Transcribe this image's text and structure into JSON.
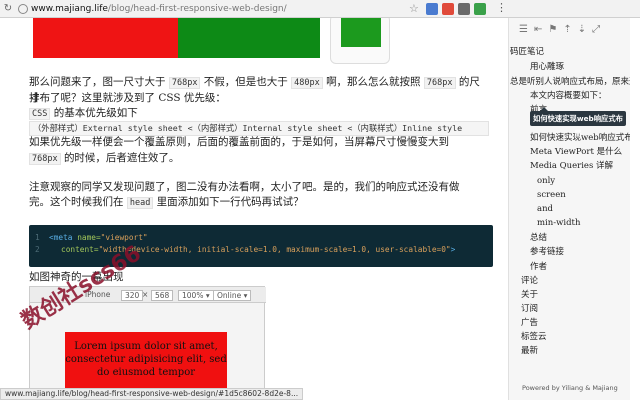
{
  "browser": {
    "domain": "www.majiang.life",
    "path": "/blog/head-first-responsive-web-design/",
    "status_url": "www.majiang.life/blog/head-first-responsive-web-design/#1d5c8602-8d2e-8..."
  },
  "article": {
    "para1_a": "那么问题来了，图一尺寸大于",
    "para1_code1": "768px",
    "para1_b": "不假，但是也大于",
    "para1_code2": "480px",
    "para1_c": "啊，那么怎么就按照",
    "para1_code3": "768px",
    "para1_d": "的尺寸",
    "para2": "排布了呢？这里就涉及到了 CSS 优先级：",
    "para3_code": "CSS",
    "para3": "的基本优先级如下",
    "priority_line": "（外部样式）External style sheet <（内部样式）Internal style sheet <（内联样式）Inline style",
    "para4": "如果优先级一样便会一个覆盖原则，后面的覆盖前面的，于是如何，当屏幕尺寸慢慢变大到",
    "para5_code": "768px",
    "para5": "的时候，后者遮住效了。",
    "para6": "注意观察的同学又发现问题了，图二没有办法看啊，太小了吧。是的，我们的响应式还没有做",
    "para7_a": "完。这个时候我们在",
    "para7_code": "head",
    "para7_b": "里面添加如下一行代码再试试？",
    "code_line1_num": "1",
    "code_line2_num": "2",
    "code_tag": "<meta",
    "code_attr1": "name=",
    "code_val1": "\"viewport\"",
    "code_attr2": "content=",
    "code_val2": "\"width=device-width, initial-scale=1.0, maximum-scale=1.0, user-scalable=0\"",
    "code_end": ">",
    "para8": "如图神奇的一幕出现",
    "shot_device": "iPhone",
    "shot_w": "320",
    "shot_h": "568",
    "shot_zoom": "100% ▾",
    "shot_net": "Online ▾",
    "lorem": "Lorem ipsum dolor sit amet, consectetur adipisicing elit, sed do eiusmod tempor",
    "watermark": "数创社scs66"
  },
  "sidebar": {
    "toc": [
      "码匠笔记",
      "用心雕琢",
      "总是听别人说响应式布局，原来这",
      "本文内容概要如下：",
      "前言",
      "如何快速实现web响应式布局",
      "Meta ViewPort 是什么",
      "Media Queries 详解",
      "only",
      "screen",
      "and",
      "min-width",
      "总结",
      "参考链接",
      "作者",
      "评论",
      "关于",
      "订阅",
      "广告",
      "标签云",
      "最新"
    ],
    "tooltip": "如何快速实现web响应式布局",
    "powered": "Powered by Yiliang & Majiang"
  }
}
